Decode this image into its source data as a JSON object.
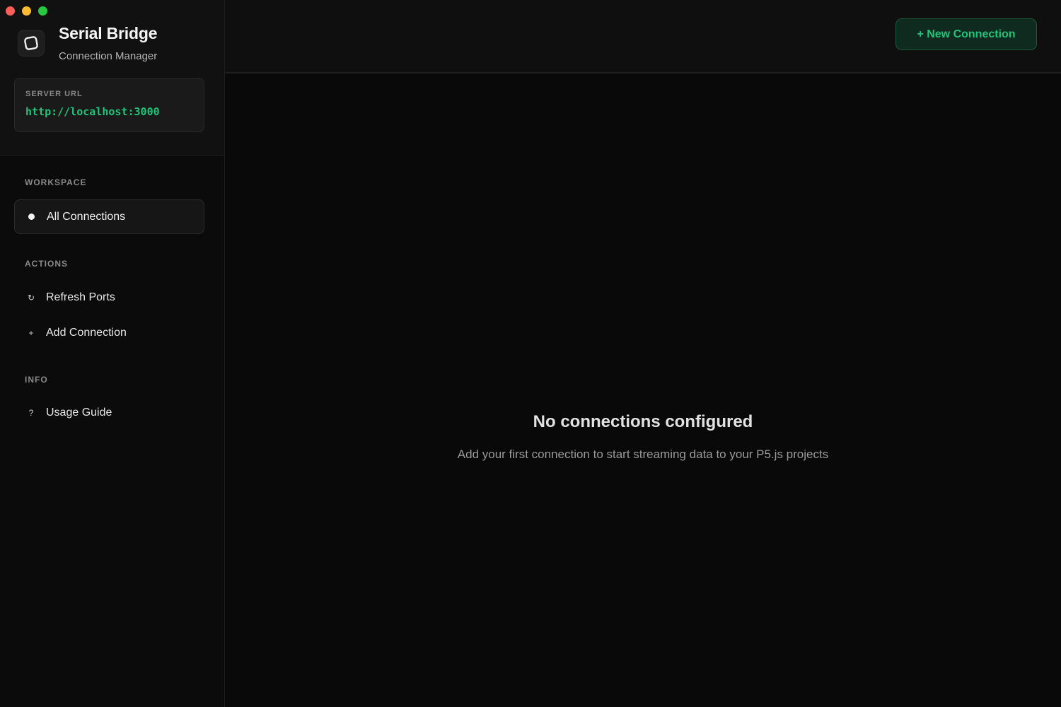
{
  "window": {
    "controls": [
      "close",
      "minimize",
      "zoom"
    ]
  },
  "brand": {
    "title": "Serial Bridge",
    "subtitle": "Connection Manager",
    "logo_icon": "rounded-square-logo-icon"
  },
  "server": {
    "label": "SERVER URL",
    "url": "http://localhost:3000"
  },
  "sidebar": {
    "workspace_label": "WORKSPACE",
    "workspace_items": [
      {
        "label": "All Connections",
        "icon": "dot-icon",
        "active": true
      }
    ],
    "actions_label": "ACTIONS",
    "action_items": [
      {
        "label": "Refresh Ports",
        "icon": "refresh-icon",
        "glyph": "↻"
      },
      {
        "label": "Add Connection",
        "icon": "plus-icon",
        "glyph": "+"
      }
    ],
    "info_label": "INFO",
    "info_items": [
      {
        "label": "Usage Guide",
        "icon": "question-icon",
        "glyph": "?"
      }
    ]
  },
  "header": {
    "new_connection_label": "+ New Connection"
  },
  "empty_state": {
    "title": "No connections configured",
    "subtitle": "Add your first connection to start streaming data to your P5.js projects"
  },
  "colors": {
    "accent": "#22c37a",
    "background": "#0a0a0a",
    "sidebar_header": "#111111"
  }
}
